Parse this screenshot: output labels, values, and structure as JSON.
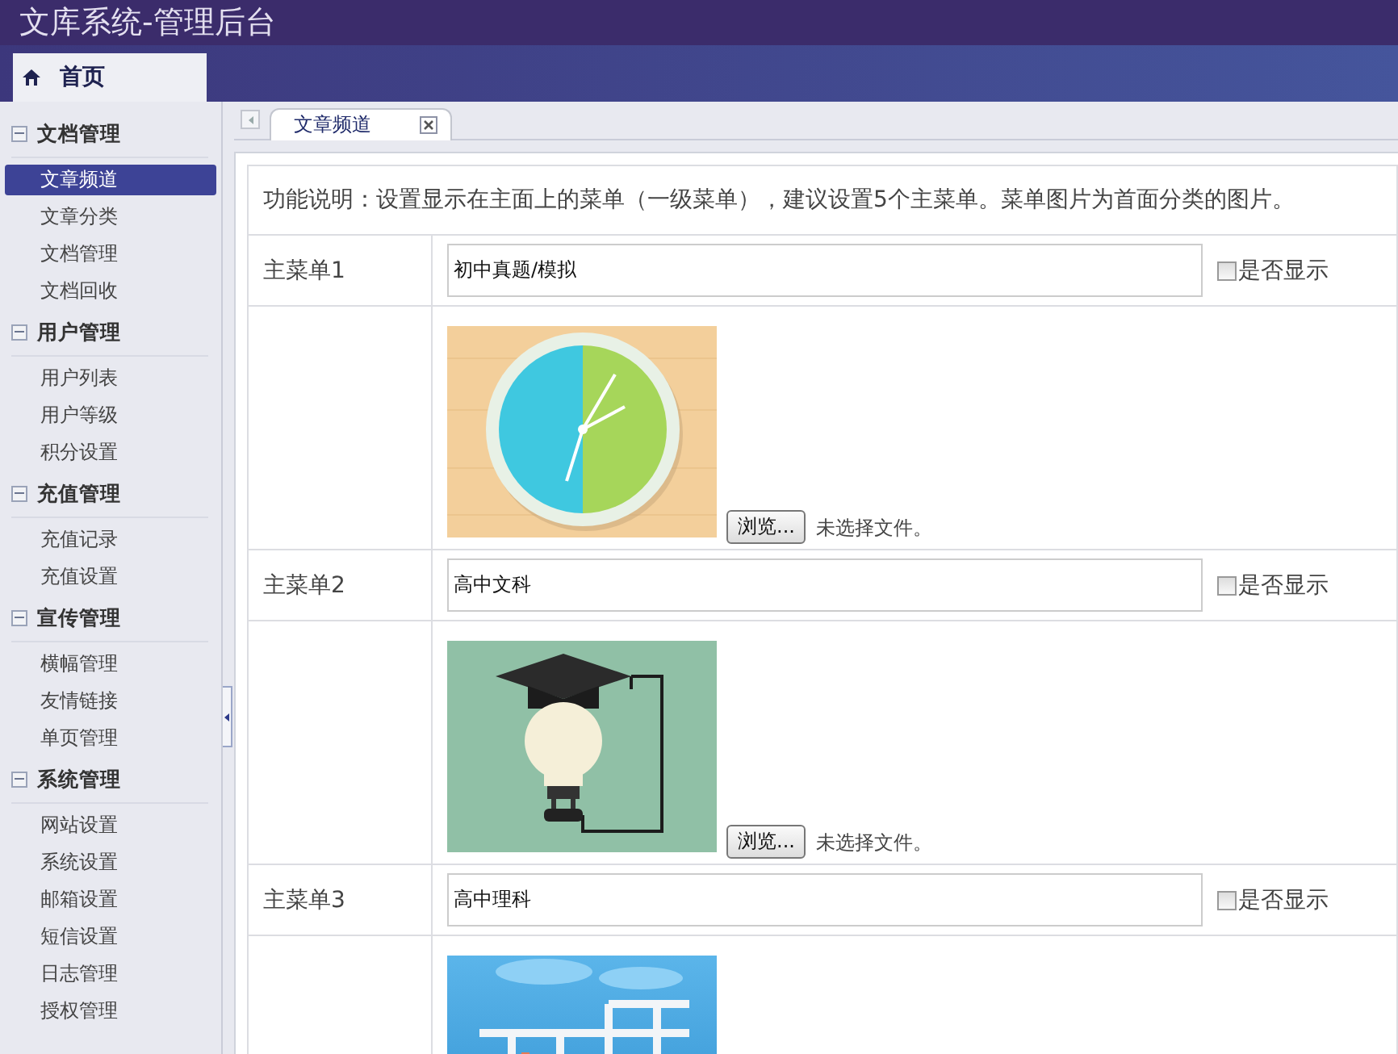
{
  "window": {
    "title": "文库系统-管理后台"
  },
  "top_tabs": [
    {
      "label": "首页",
      "selected": true
    }
  ],
  "sidebar": {
    "groups": [
      {
        "title": "文档管理",
        "expanded": true,
        "items": [
          {
            "label": "文章频道",
            "selected": true
          },
          {
            "label": "文章分类",
            "selected": false
          },
          {
            "label": "文档管理",
            "selected": false
          },
          {
            "label": "文档回收",
            "selected": false
          }
        ]
      },
      {
        "title": "用户管理",
        "expanded": true,
        "items": [
          {
            "label": "用户列表",
            "selected": false
          },
          {
            "label": "用户等级",
            "selected": false
          },
          {
            "label": "积分设置",
            "selected": false
          }
        ]
      },
      {
        "title": "充值管理",
        "expanded": true,
        "items": [
          {
            "label": "充值记录",
            "selected": false
          },
          {
            "label": "充值设置",
            "selected": false
          }
        ]
      },
      {
        "title": "宣传管理",
        "expanded": true,
        "items": [
          {
            "label": "横幅管理",
            "selected": false
          },
          {
            "label": "友情链接",
            "selected": false
          },
          {
            "label": "单页管理",
            "selected": false
          }
        ]
      },
      {
        "title": "系统管理",
        "expanded": true,
        "items": [
          {
            "label": "网站设置",
            "selected": false
          },
          {
            "label": "系统设置",
            "selected": false
          },
          {
            "label": "邮箱设置",
            "selected": false
          },
          {
            "label": "短信设置",
            "selected": false
          },
          {
            "label": "日志管理",
            "selected": false
          },
          {
            "label": "授权管理",
            "selected": false
          }
        ]
      }
    ]
  },
  "page_tabs": [
    {
      "label": "文章频道",
      "selected": true
    }
  ],
  "description": "功能说明：设置显示在主面上的菜单（一级菜单），建议设置5个主菜单。菜单图片为首面分类的图片。",
  "menus": [
    {
      "label": "主菜单1",
      "value": "初中真题/模拟",
      "show_label": "是否显示",
      "show_checked": false,
      "kind": "clock",
      "browse_button": "浏览...",
      "file_status": "未选择文件。"
    },
    {
      "label": "主菜单2",
      "value": "高中文科",
      "show_label": "是否显示",
      "show_checked": false,
      "kind": "lightbulb",
      "browse_button": "浏览...",
      "file_status": "未选择文件。"
    },
    {
      "label": "主菜单3",
      "value": "高中理科",
      "show_label": "是否显示",
      "show_checked": false,
      "kind": "shelves"
    }
  ]
}
